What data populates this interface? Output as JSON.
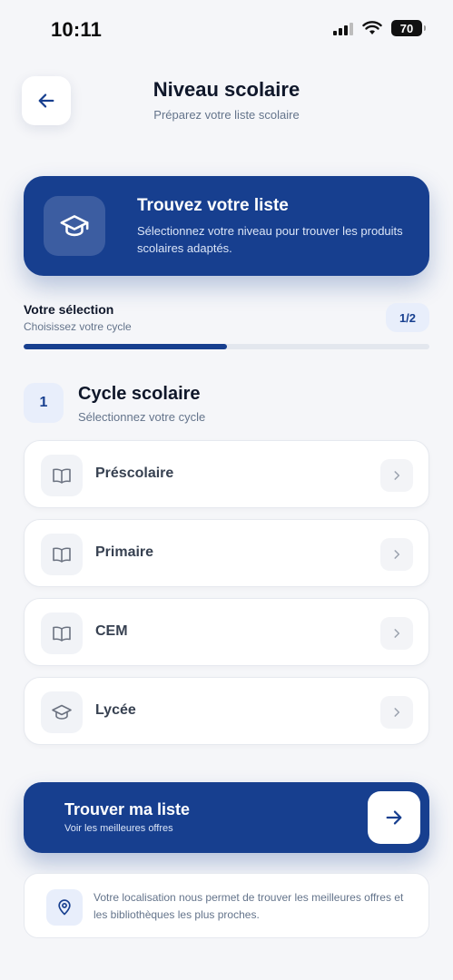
{
  "status_bar": {
    "time": "10:11",
    "battery": "70"
  },
  "header": {
    "title": "Niveau scolaire",
    "subtitle": "Préparez votre liste scolaire",
    "back_icon": "arrow-left-icon"
  },
  "hero": {
    "title": "Trouvez votre liste",
    "description": "Sélectionnez votre niveau pour trouver les produits scolaires adaptés.",
    "icon": "graduation-cap-icon"
  },
  "selection": {
    "title": "Votre sélection",
    "subtitle": "Choisissez votre cycle",
    "step": "1/2",
    "progress": 0.5
  },
  "section": {
    "number": "1",
    "title": "Cycle scolaire",
    "subtitle": "Sélectionnez votre cycle"
  },
  "options": [
    {
      "label": "Préscolaire",
      "icon": "book-icon"
    },
    {
      "label": "Primaire",
      "icon": "book-icon"
    },
    {
      "label": "CEM",
      "icon": "book-icon"
    },
    {
      "label": "Lycée",
      "icon": "graduation-cap-icon"
    }
  ],
  "cta": {
    "title": "Trouver ma liste",
    "subtitle": "Voir les meilleures offres",
    "icon": "arrow-right-icon"
  },
  "info": {
    "text": "Votre localisation nous permet de trouver les meilleures offres et les bibliothèques les plus proches.",
    "icon": "location-pin-icon"
  },
  "colors": {
    "primary": "#173f8f",
    "background": "#f5f6f9"
  }
}
